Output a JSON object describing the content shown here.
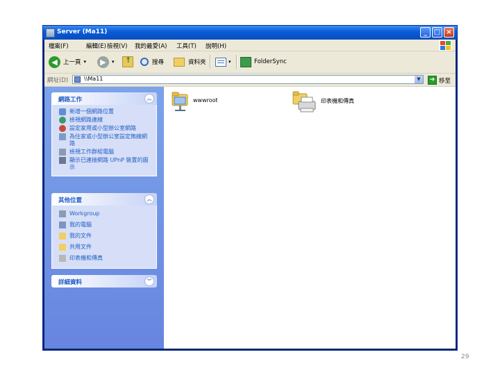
{
  "window": {
    "title": "Server (Ma11)",
    "controls": {
      "minimize": "_",
      "maximize": "□",
      "close": "×"
    }
  },
  "menu": [
    "檔案(F)",
    "編輯(E)",
    "檢視(V)",
    "我的最愛(A)",
    "工具(T)",
    "說明(H)"
  ],
  "toolbar": {
    "back_label": "上一頁",
    "search_label": "搜尋",
    "folders_label": "資料夾",
    "foldersync_label": "FolderSync"
  },
  "address": {
    "label": "網址(D)",
    "value": "\\\\Ma11",
    "go_label": "移至"
  },
  "panels": [
    {
      "title": "網路工作",
      "chevron": "up",
      "links": [
        {
          "icon": "network-place-icon",
          "label": "新增一個網路位置"
        },
        {
          "icon": "network-connections-icon",
          "label": "檢視網路連線"
        },
        {
          "icon": "home-network-icon",
          "label": "設定家用或小型辦公室網路"
        },
        {
          "icon": "wireless-network-icon",
          "label": "為住家或小型辦公室設定無線網路"
        },
        {
          "icon": "workgroup-computers-icon",
          "label": "檢視工作群組電腦"
        },
        {
          "icon": "upnp-icon",
          "label": "顯示已連接網路 UPnP 裝置的圖示"
        }
      ]
    },
    {
      "title": "其他位置",
      "chevron": "up",
      "links": [
        {
          "icon": "workgroup-icon",
          "label": "Workgroup"
        },
        {
          "icon": "my-computer-icon",
          "label": "我的電腦"
        },
        {
          "icon": "my-documents-icon",
          "label": "我的文件"
        },
        {
          "icon": "shared-documents-icon",
          "label": "共用文件"
        },
        {
          "icon": "printers-icon",
          "label": "印表機和傳真"
        }
      ]
    },
    {
      "title": "詳細資料",
      "chevron": "down",
      "links": []
    }
  ],
  "items": [
    {
      "icon": "shared-folder-icon",
      "label": "wwwroot"
    },
    {
      "icon": "printers-folder-icon",
      "label": "印表機和傳真"
    }
  ],
  "page_number": "29",
  "colors": {
    "titlebar": "#0a5fd8",
    "taskpane": "#7ba3ea",
    "link": "#215dc6"
  }
}
